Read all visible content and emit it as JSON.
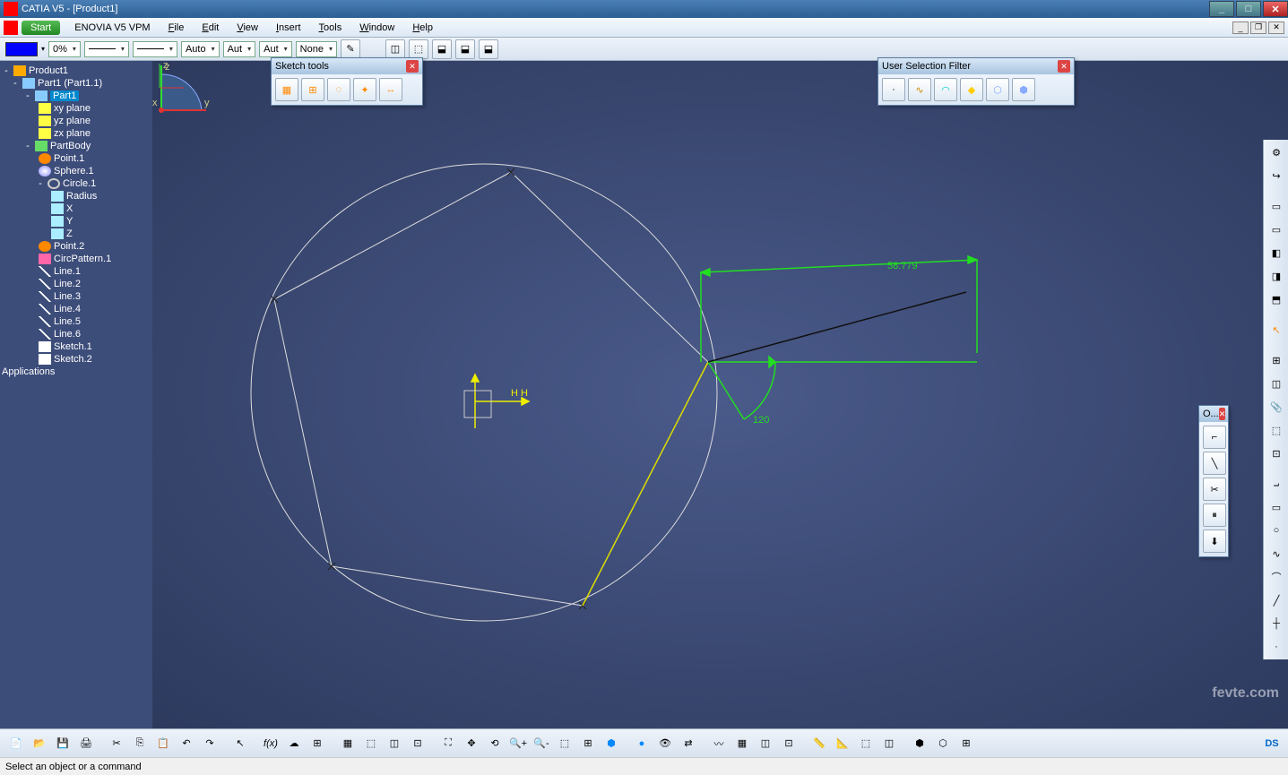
{
  "window": {
    "title": "CATIA V5 - [Product1]"
  },
  "menu": {
    "start": "Start",
    "items": [
      "ENOVIA V5 VPM",
      "File",
      "Edit",
      "View",
      "Insert",
      "Tools",
      "Window",
      "Help"
    ]
  },
  "options_row": {
    "opacity": "0%",
    "auto1": "Auto",
    "auto2": "Aut",
    "auto3": "Aut",
    "none": "None"
  },
  "tree": {
    "root": "Product1",
    "part_inst": "Part1 (Part1.1)",
    "part": "Part1",
    "planes": [
      "xy plane",
      "yz plane",
      "zx plane"
    ],
    "body": "PartBody",
    "features": [
      {
        "label": "Point.1",
        "icon": "ic-point"
      },
      {
        "label": "Sphere.1",
        "icon": "ic-sph"
      },
      {
        "label": "Circle.1",
        "icon": "ic-circ"
      }
    ],
    "circle_params": [
      "Radius",
      "X",
      "Y",
      "Z"
    ],
    "features2": [
      {
        "label": "Point.2",
        "icon": "ic-point"
      },
      {
        "label": "CircPattern.1",
        "icon": "ic-pat"
      },
      {
        "label": "Line.1",
        "icon": "ic-line"
      },
      {
        "label": "Line.2",
        "icon": "ic-line"
      },
      {
        "label": "Line.3",
        "icon": "ic-line"
      },
      {
        "label": "Line.4",
        "icon": "ic-line"
      },
      {
        "label": "Line.5",
        "icon": "ic-line"
      },
      {
        "label": "Line.6",
        "icon": "ic-line"
      },
      {
        "label": "Sketch.1",
        "icon": "ic-sketch"
      },
      {
        "label": "Sketch.2",
        "icon": "ic-sketch"
      }
    ],
    "applications": "Applications"
  },
  "float_toolbars": {
    "sketch_tools": {
      "title": "Sketch tools"
    },
    "usf": {
      "title": "User Selection Filter"
    },
    "o": {
      "title": "O..."
    }
  },
  "viewport": {
    "dim_length": "58.779",
    "angle": "120",
    "axis_h": "H H",
    "compass": {
      "x": "x",
      "y": "y",
      "z": "z"
    }
  },
  "status": {
    "text": "Select an object or a command"
  },
  "watermark": "fevte.com"
}
